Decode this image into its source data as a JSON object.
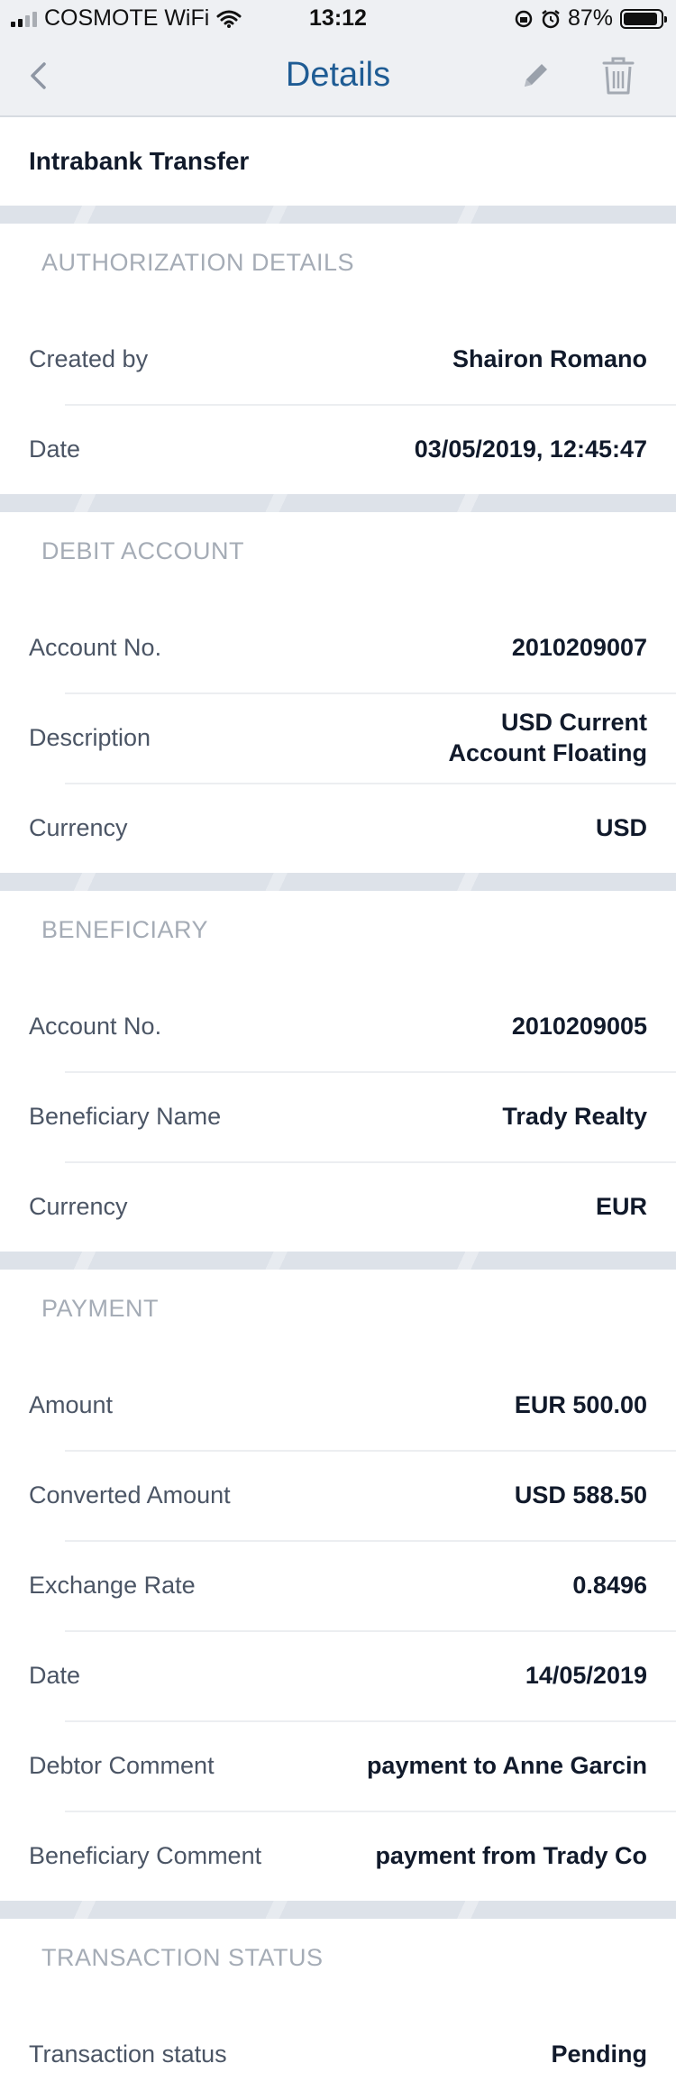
{
  "status_bar": {
    "carrier": "COSMOTE WiFi",
    "time": "13:12",
    "battery": "87%",
    "battery_level": 0.87
  },
  "nav": {
    "title": "Details",
    "back_icon": "chevron-left-icon",
    "edit_icon": "pencil-icon",
    "delete_icon": "trash-icon"
  },
  "transfer_type": "Intrabank Transfer",
  "sections": {
    "authorization": {
      "title": "AUTHORIZATION DETAILS",
      "rows": [
        {
          "label": "Created by",
          "value": "Shairon Romano"
        },
        {
          "label": "Date",
          "value": "03/05/2019, 12:45:47"
        }
      ]
    },
    "debit": {
      "title": "DEBIT ACCOUNT",
      "rows": [
        {
          "label": "Account No.",
          "value": "2010209007"
        },
        {
          "label": "Description",
          "value": "USD Current Account Floating"
        },
        {
          "label": "Currency",
          "value": "USD"
        }
      ]
    },
    "beneficiary": {
      "title": "BENEFICIARY",
      "rows": [
        {
          "label": "Account No.",
          "value": "2010209005"
        },
        {
          "label": "Beneficiary Name",
          "value": "Trady Realty"
        },
        {
          "label": "Currency",
          "value": "EUR"
        }
      ]
    },
    "payment": {
      "title": "PAYMENT",
      "rows": [
        {
          "label": "Amount",
          "value": "EUR 500.00"
        },
        {
          "label": "Converted Amount",
          "value": "USD 588.50"
        },
        {
          "label": "Exchange Rate",
          "value": "0.8496"
        },
        {
          "label": "Date",
          "value": "14/05/2019"
        },
        {
          "label": "Debtor Comment",
          "value": "payment to Anne Garcin"
        },
        {
          "label": "Beneficiary Comment",
          "value": "payment from Trady Co"
        }
      ]
    },
    "status": {
      "title": "TRANSACTION STATUS",
      "rows": [
        {
          "label": "Transaction status",
          "value": "Pending"
        }
      ]
    }
  }
}
